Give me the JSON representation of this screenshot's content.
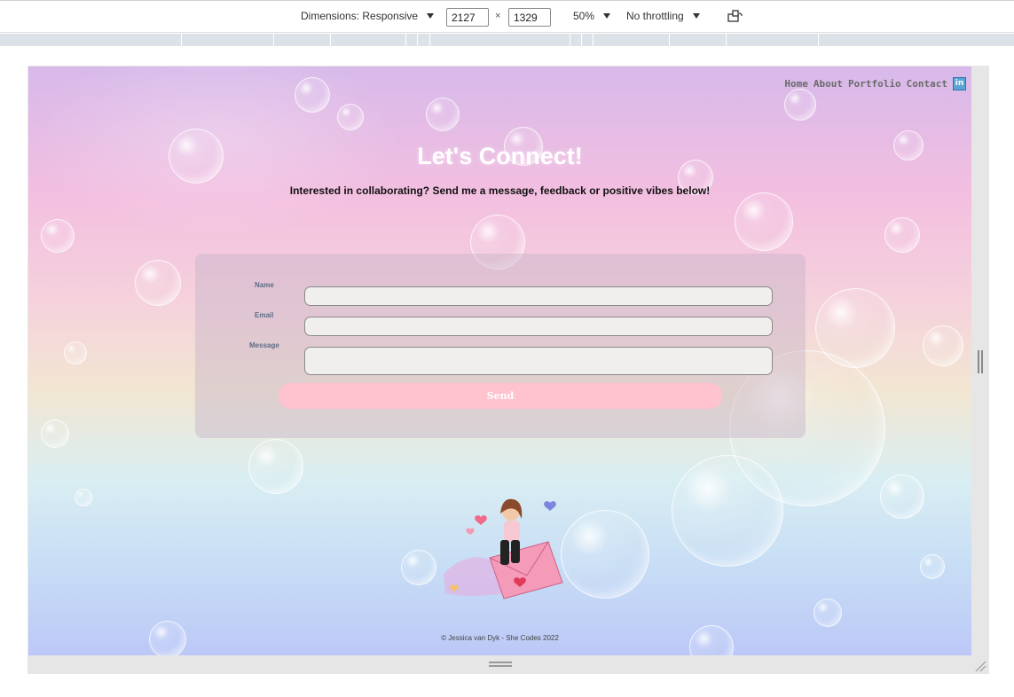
{
  "devtools": {
    "dimensions_label": "Dimensions: Responsive",
    "width_value": "2127",
    "height_value": "1329",
    "times_symbol": "×",
    "zoom": "50%",
    "throttling": "No throttling",
    "rotate_icon": "rotate-device-icon"
  },
  "page": {
    "nav": {
      "items": [
        "Home",
        "About",
        "Portfolio",
        "Contact"
      ],
      "linkedin_icon": "linkedin-icon",
      "linkedin_glyph": "in"
    },
    "title": "Let's Connect!",
    "subtitle": "Interested in collaborating? Send me a message, feedback or positive vibes below!",
    "form": {
      "name_label": "Name",
      "email_label": "Email",
      "message_label": "Message",
      "name_value": "",
      "email_value": "",
      "message_value": "",
      "send_label": "Send"
    },
    "footer": "© Jessica van Dyk - She Codes 2022"
  },
  "colors": {
    "send_button": "#ffc2cf",
    "panel": "#c8b4c8",
    "title": "#ffffff"
  }
}
